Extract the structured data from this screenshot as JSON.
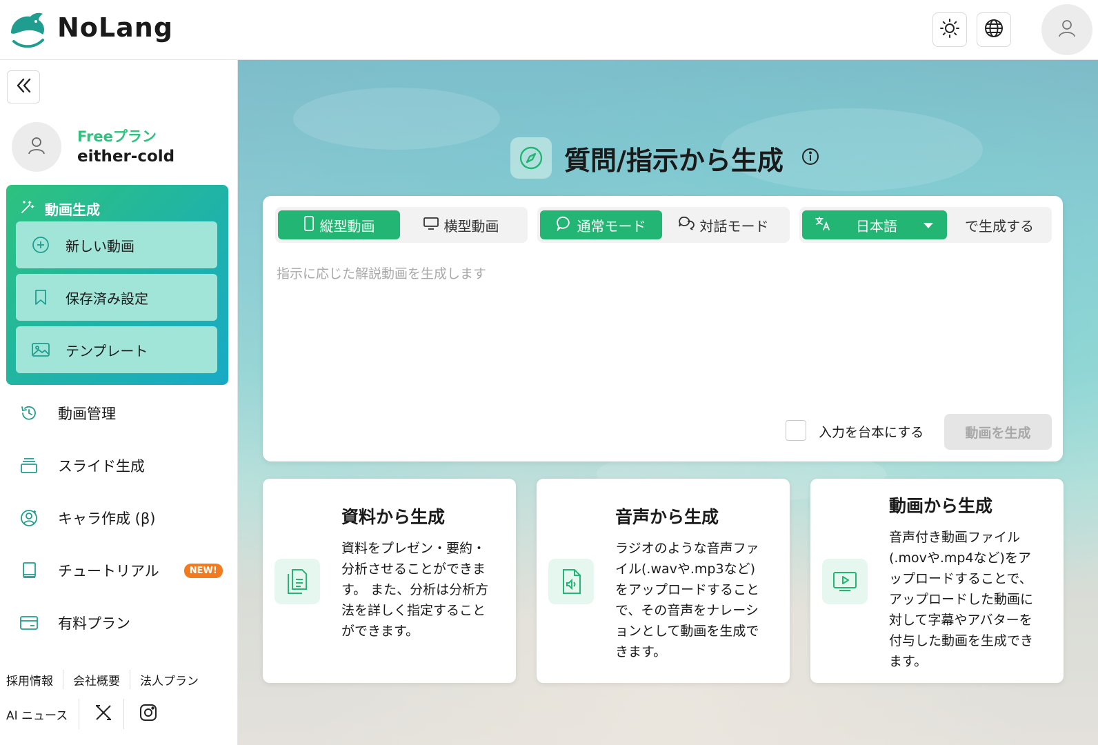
{
  "header": {
    "brand": "NoLang",
    "colors": {
      "accent": "#22b573",
      "brand_teal": "#1f9e8f"
    }
  },
  "sidebar": {
    "plan": "Freeプラン",
    "username": "either-cold",
    "generate_section": {
      "title": "動画生成",
      "items": [
        {
          "label": "新しい動画",
          "icon": "plus-circle-icon"
        },
        {
          "label": "保存済み設定",
          "icon": "bookmark-icon"
        },
        {
          "label": "テンプレート",
          "icon": "image-icon"
        }
      ]
    },
    "nav": [
      {
        "label": "動画管理",
        "icon": "history-icon"
      },
      {
        "label": "スライド生成",
        "icon": "slides-icon"
      },
      {
        "label": "キャラ作成 (β)",
        "icon": "user-circle-icon"
      },
      {
        "label": "チュートリアル",
        "icon": "book-icon",
        "badge": "NEW!"
      },
      {
        "label": "有料プラン",
        "icon": "credit-card-icon"
      }
    ],
    "footer": {
      "links": [
        "採用情報",
        "会社概要",
        "法人プラン"
      ],
      "news": "AI ニュース"
    }
  },
  "main": {
    "title": "質問/指示から生成",
    "format_tabs": [
      "縦型動画",
      "横型動画"
    ],
    "mode_tabs": [
      "通常モード",
      "対話モード"
    ],
    "language": "日本語",
    "language_suffix": "で生成する",
    "placeholder": "指示に応じた解説動画を生成します",
    "script_checkbox_label": "入力を台本にする",
    "generate_button": "動画を生成",
    "features": [
      {
        "title": "資料から生成",
        "desc": "資料をプレゼン・要約・分析させることができます。 また、分析は分析方法を詳しく指定することができます。",
        "icon": "document-icon"
      },
      {
        "title": "音声から生成",
        "desc": "ラジオのような音声ファイル(.wavや.mp3など)をアップロードすることで、その音声をナレーションとして動画を生成できます。",
        "icon": "audio-file-icon"
      },
      {
        "title": "動画から生成",
        "desc": "音声付き動画ファイル(.movや.mp4など)をアップロードすることで、アップロードした動画に対して字幕やアバターを付与した動画を生成できます。",
        "icon": "video-icon"
      }
    ]
  }
}
